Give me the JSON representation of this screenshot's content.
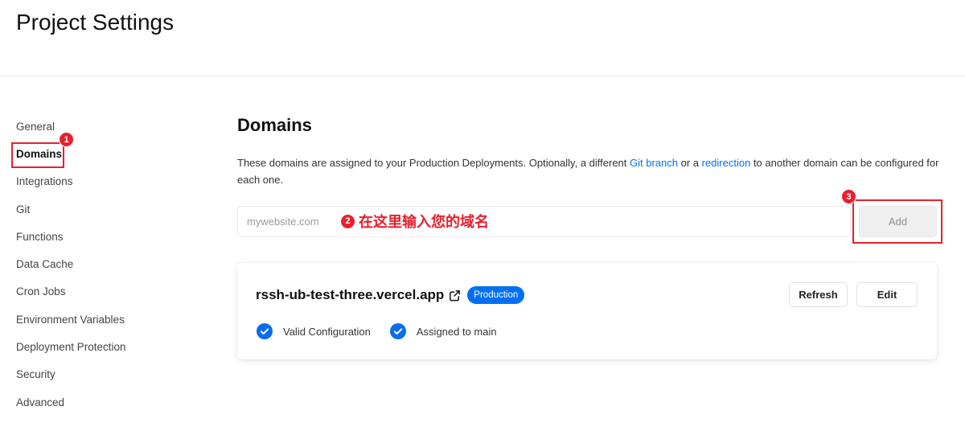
{
  "header": {
    "title": "Project Settings"
  },
  "sidebar": {
    "items": [
      {
        "label": "General",
        "active": false
      },
      {
        "label": "Domains",
        "active": true
      },
      {
        "label": "Integrations",
        "active": false
      },
      {
        "label": "Git",
        "active": false
      },
      {
        "label": "Functions",
        "active": false
      },
      {
        "label": "Data Cache",
        "active": false
      },
      {
        "label": "Cron Jobs",
        "active": false
      },
      {
        "label": "Environment Variables",
        "active": false
      },
      {
        "label": "Deployment Protection",
        "active": false
      },
      {
        "label": "Security",
        "active": false
      },
      {
        "label": "Advanced",
        "active": false
      }
    ]
  },
  "main": {
    "heading": "Domains",
    "description": {
      "text_1": "These domains are assigned to your Production Deployments. Optionally, a different ",
      "link_git_branch": "Git branch",
      "text_2": " or a ",
      "link_redirection": "redirection",
      "text_3": " to another domain can be configured for each one."
    },
    "domain_input": {
      "placeholder": "mywebsite.com",
      "value": ""
    },
    "add_button": {
      "label": "Add"
    },
    "domain_card": {
      "domain": "rssh-ub-test-three.vercel.app",
      "domain_icon": "external-link-icon",
      "badge": "Production",
      "refresh_label": "Refresh",
      "edit_label": "Edit",
      "statuses": [
        {
          "label": "Valid Configuration",
          "icon": "check-circle-icon"
        },
        {
          "label": "Assigned to main",
          "icon": "check-circle-icon"
        }
      ]
    }
  },
  "annotations": {
    "step_1": {
      "number": "1"
    },
    "step_2": {
      "number": "2",
      "text": "在这里输入您的域名"
    },
    "step_3": {
      "number": "3"
    }
  },
  "colors": {
    "accent": "#0070f3",
    "annotation_red": "#e8202d",
    "check_blue": "#0a6cf0"
  }
}
